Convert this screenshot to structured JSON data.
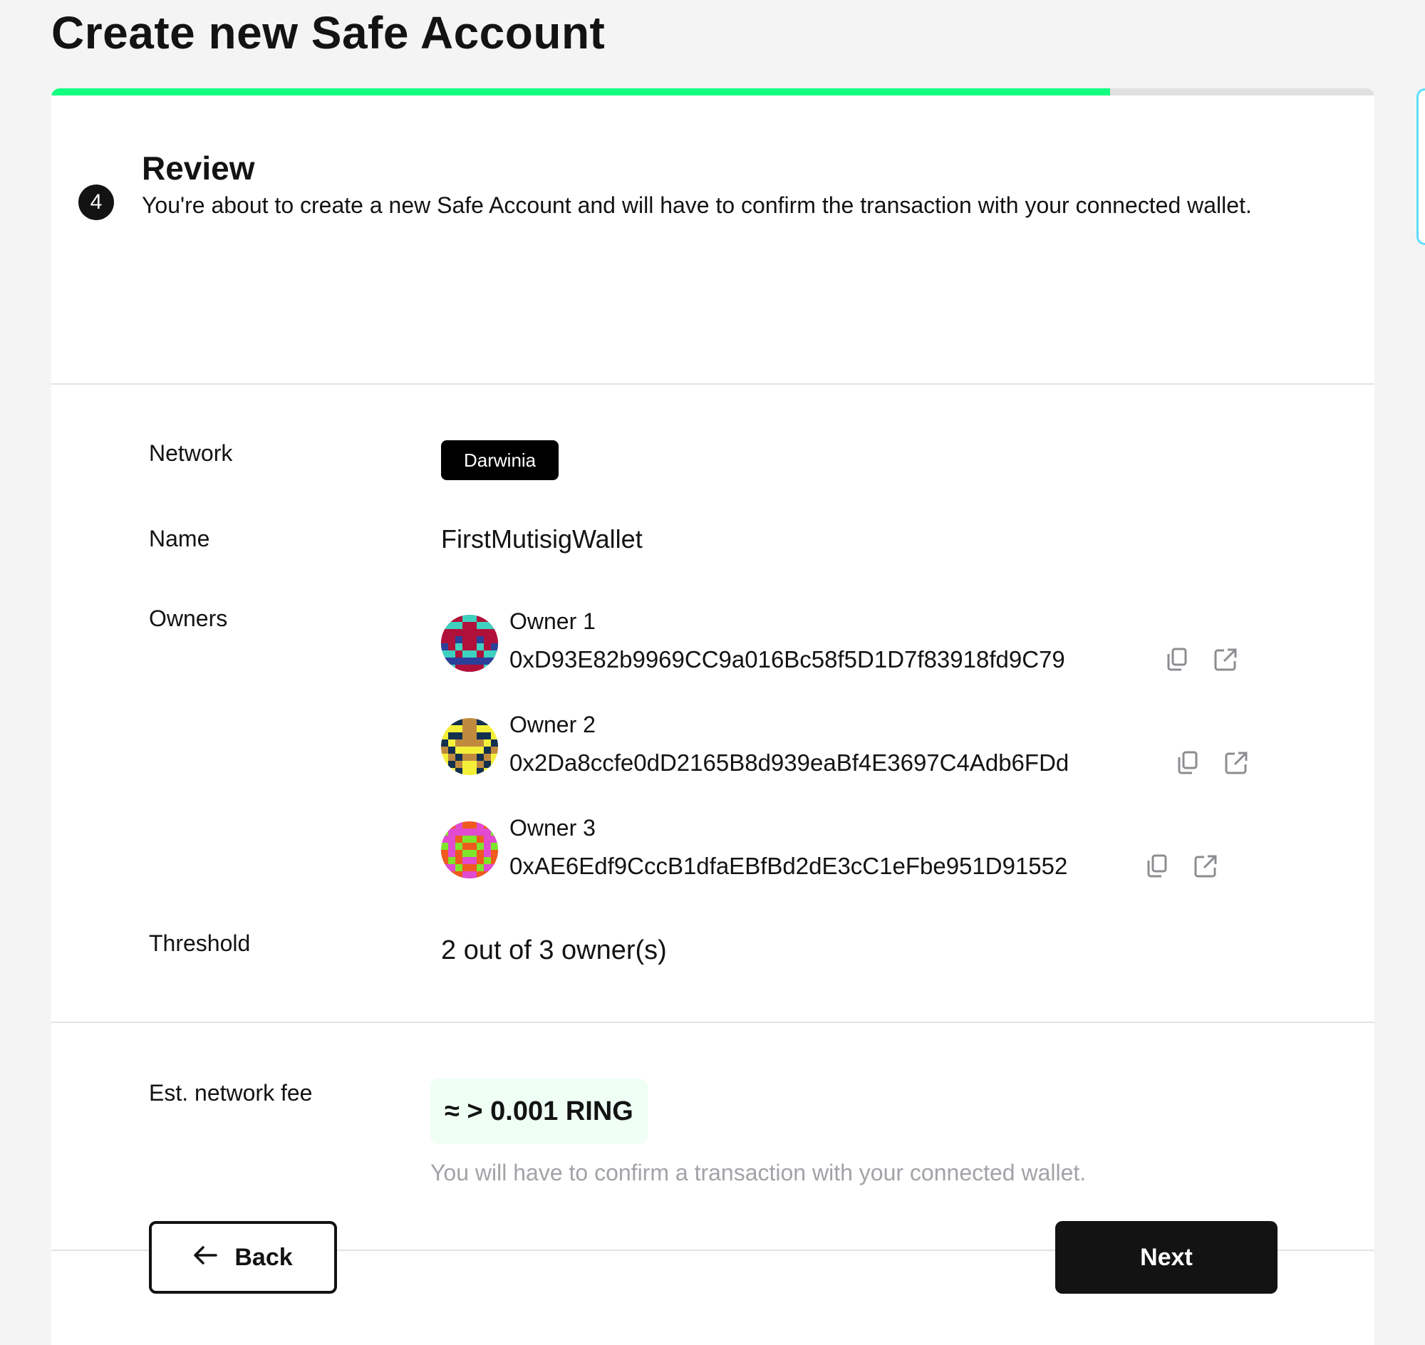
{
  "page_title": "Create new Safe Account",
  "progress": {
    "value": 0.8
  },
  "step": {
    "number": "4",
    "title": "Review",
    "description": "You're about to create a new Safe Account and will have to confirm the transaction with your connected wallet."
  },
  "review": {
    "network_label": "Network",
    "network_value": "Darwinia",
    "name_label": "Name",
    "name_value": "FirstMutisigWallet",
    "owners_label": "Owners",
    "owners": [
      {
        "name": "Owner 1",
        "address": "0xD93E82b9969CC9a016Bc58f5D1D7f83918fd9C79",
        "avatar_colors": [
          "#b0113a",
          "#2c3f9a",
          "#3fd1c0"
        ]
      },
      {
        "name": "Owner 2",
        "address": "0x2Da8ccfe0dD2165B8d939eaBf4E3697C4Adb6FDd",
        "avatar_colors": [
          "#f4f03a",
          "#13304f",
          "#c08a3e"
        ]
      },
      {
        "name": "Owner 3",
        "address": "0xAE6Edf9CccB1dfaEBfBd2dE3cC1eFbe951D91552",
        "avatar_colors": [
          "#e24ad0",
          "#7fe52a",
          "#f05a1e"
        ]
      }
    ],
    "threshold_label": "Threshold",
    "threshold_value": "2 out of 3 owner(s)"
  },
  "fee": {
    "label": "Est. network fee",
    "value": "≈ > 0.001 RING",
    "note": "You will have to confirm a transaction with your connected wallet."
  },
  "actions": {
    "back_label": "Back",
    "next_label": "Next"
  },
  "icons": {
    "copy": "copy-icon",
    "external": "external-link-icon",
    "back_arrow": "arrow-left-icon"
  },
  "colors": {
    "accent": "#12ff80",
    "text": "#121312",
    "muted": "#a1a3a7",
    "fee_bg": "#effff4"
  }
}
